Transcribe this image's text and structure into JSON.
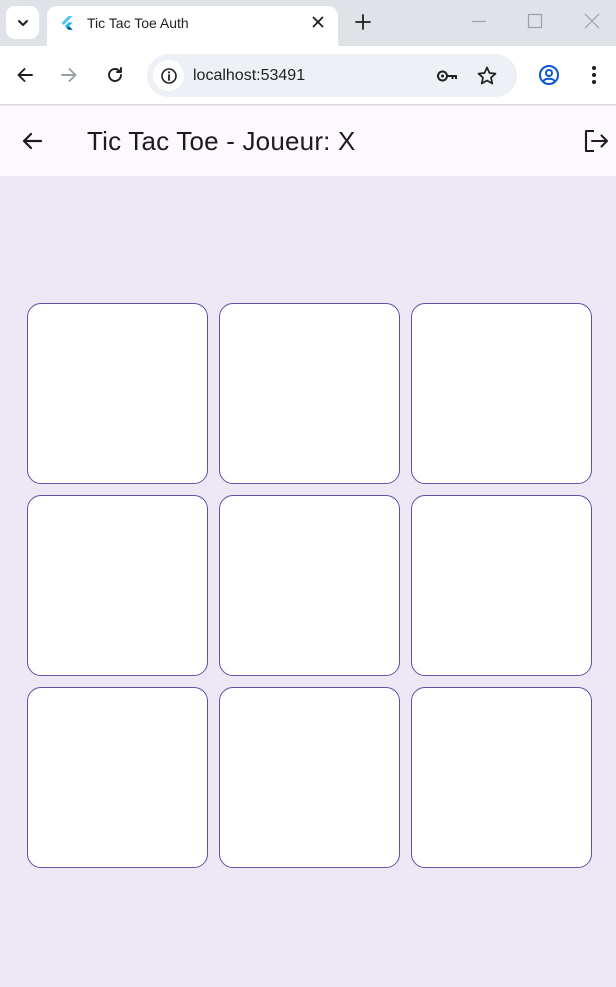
{
  "browser": {
    "tab": {
      "title": "Tic Tac Toe Auth",
      "favicon": "flutter-icon"
    },
    "url": "localhost:53491",
    "icons": {
      "tab_search": "chevron-down-icon",
      "close_tab": "close-icon",
      "new_tab": "plus-icon",
      "back": "arrow-left-icon",
      "forward": "arrow-right-icon",
      "reload": "reload-icon",
      "site_info": "info-icon",
      "password": "key-icon",
      "bookmark": "star-icon",
      "profile": "account-icon",
      "menu": "more-vert-icon",
      "minimize": "minimize-icon",
      "maximize": "maximize-icon",
      "close_window": "close-icon"
    }
  },
  "app": {
    "title": "Tic Tac Toe - Joueur: X",
    "back_icon": "arrow-back-icon",
    "logout_icon": "logout-icon",
    "board": {
      "cells": [
        "",
        "",
        "",
        "",
        "",
        "",
        "",
        "",
        ""
      ]
    }
  },
  "colors": {
    "background": "#ede7f6",
    "appbar": "#fdf7fe",
    "cell_border": "#6750a4",
    "cell_fill": "#ffffff"
  }
}
